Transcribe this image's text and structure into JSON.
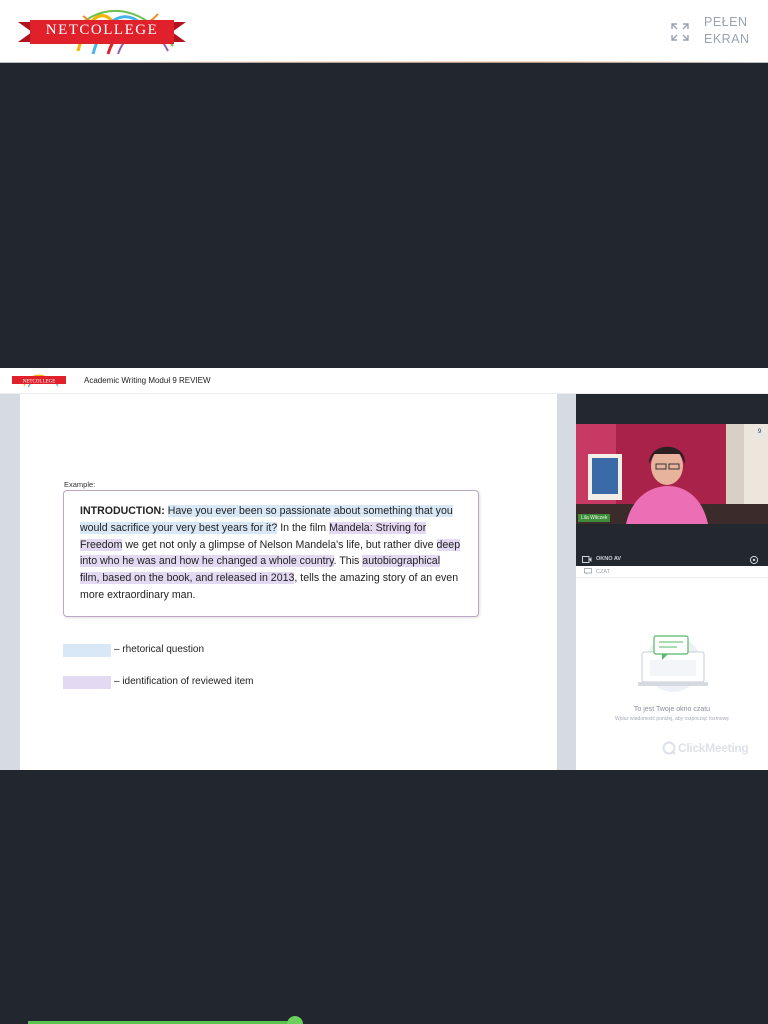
{
  "header": {
    "logo_text": "NETCOLLEGE",
    "fullscreen_label": "PEŁEN EKRAN",
    "fullscreen_icon": "expand-icon"
  },
  "stream": {
    "mini_logo_text": "NETCOLLEGE",
    "title": "Academic Writing Moduł 9 REVIEW",
    "slide": {
      "example_label": "Example:",
      "intro_heading": "INTRODUCTION:",
      "segments": [
        {
          "text": "Have you ever been so passionate about something that you would sacrifice your very best years for it?",
          "highlight": "blue"
        },
        {
          "text": " In the film ",
          "highlight": "none"
        },
        {
          "text": "Mandela: Striving for Freedom",
          "highlight": "purple"
        },
        {
          "text": " we get not only a glimpse of Nelson Mandela's life, but rather dive ",
          "highlight": "none"
        },
        {
          "text": "deep into who he was and how he changed a whole country",
          "highlight": "purple"
        },
        {
          "text": ". This ",
          "highlight": "none"
        },
        {
          "text": "autobiographical film, based on the book, and released in 2013",
          "highlight": "purple"
        },
        {
          "text": ", tells the amazing story of an even more extraordinary man.",
          "highlight": "none"
        }
      ],
      "legend": [
        {
          "label": "– rhetorical question",
          "color": "#d9e8f7"
        },
        {
          "label": "– identification of reviewed item",
          "color": "#e4d9f3"
        }
      ]
    },
    "side_panel": {
      "speaker_name": "Lila Wilczek",
      "participant_count": "9",
      "av_label": "OKNO AV",
      "chat_label": "CZAT",
      "chat_empty_title": "To jest Twoje okno czatu",
      "chat_empty_subtitle": "Wpisz wiadomość poniżej, aby rozpocząć rozmowę",
      "brand": "ClickMeeting"
    }
  },
  "colors": {
    "background": "#22262f",
    "accent_red": "#e0212c",
    "progress": "#5cc24f"
  }
}
